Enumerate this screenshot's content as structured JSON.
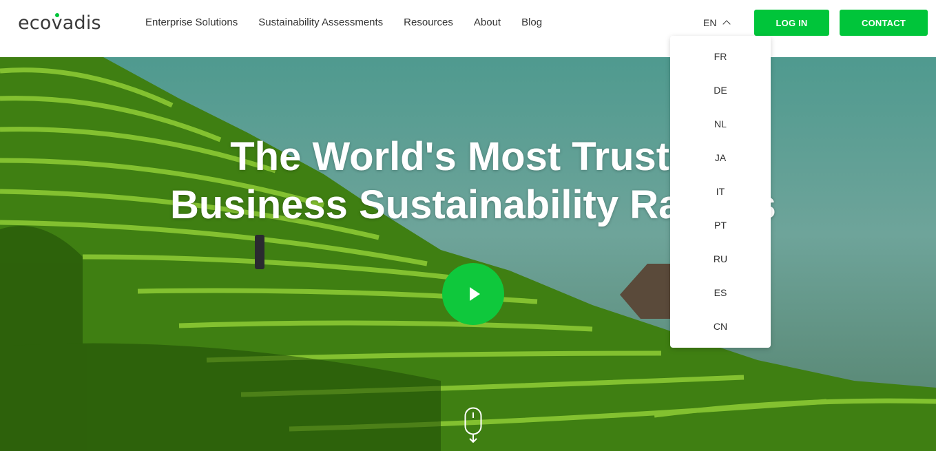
{
  "logo": {
    "text_pre": "eco",
    "text_v": "v",
    "text_post": "adis"
  },
  "nav": {
    "items": [
      {
        "label": "Enterprise Solutions"
      },
      {
        "label": "Sustainability Assessments"
      },
      {
        "label": "Resources"
      },
      {
        "label": "About"
      },
      {
        "label": "Blog"
      }
    ]
  },
  "language": {
    "current": "EN",
    "options": [
      "FR",
      "DE",
      "NL",
      "JA",
      "IT",
      "PT",
      "RU",
      "ES",
      "CN"
    ]
  },
  "buttons": {
    "login": "LOG IN",
    "contact": "CONTACT"
  },
  "hero": {
    "headline_line1": "The World's Most Trusted",
    "headline_line2": "Business Sustainability Ratings"
  },
  "colors": {
    "accent": "#00c53a",
    "text": "#333333"
  },
  "icons": {
    "play": "play-icon",
    "scroll": "scroll-mouse-icon",
    "language_toggle": "chevron-up-icon"
  }
}
